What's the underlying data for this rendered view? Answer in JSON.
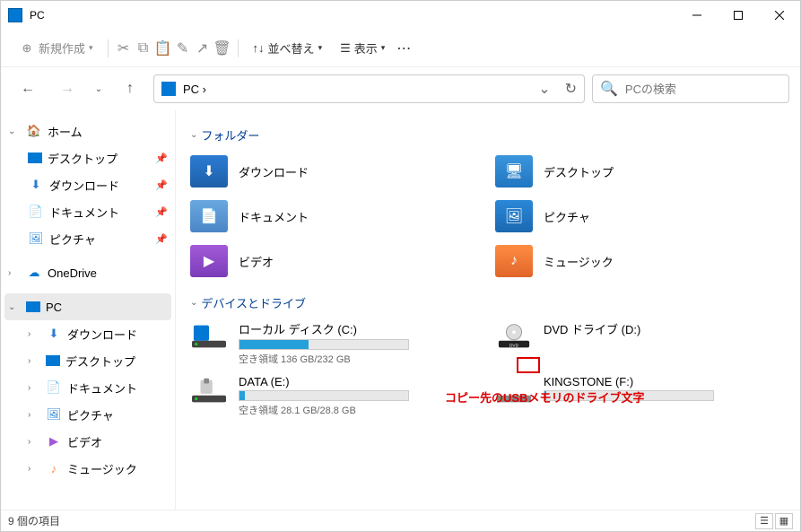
{
  "window": {
    "title": "PC"
  },
  "toolbar": {
    "new": "新規作成",
    "sort": "並べ替え",
    "view": "表示"
  },
  "nav": {
    "breadcrumb": "PC ›",
    "search_placeholder": "PCの検索"
  },
  "sidebar": {
    "home": "ホーム",
    "desktop": "デスクトップ",
    "downloads": "ダウンロード",
    "documents": "ドキュメント",
    "pictures": "ピクチャ",
    "onedrive": "OneDrive",
    "pc": "PC",
    "pc_downloads": "ダウンロード",
    "pc_desktop": "デスクトップ",
    "pc_documents": "ドキュメント",
    "pc_pictures": "ピクチャ",
    "pc_videos": "ビデオ",
    "pc_music": "ミュージック"
  },
  "sections": {
    "folders": "フォルダー",
    "drives": "デバイスとドライブ"
  },
  "folders": {
    "downloads": "ダウンロード",
    "desktop": "デスクトップ",
    "documents": "ドキュメント",
    "pictures": "ピクチャ",
    "videos": "ビデオ",
    "music": "ミュージック"
  },
  "drives": {
    "c": {
      "name": "ローカル ディスク (C:)",
      "free": "空き領域 136 GB/232 GB",
      "fill": 41
    },
    "d": {
      "name": "DVD ドライブ (D:)"
    },
    "e": {
      "name": "DATA (E:)",
      "free": "空き領域 28.1 GB/28.8 GB",
      "fill": 3
    },
    "f": {
      "name": "KINGSTONE (F:)"
    }
  },
  "annotation": "コピー先のUSBメモリのドライブ文字",
  "status": "9 個の項目"
}
